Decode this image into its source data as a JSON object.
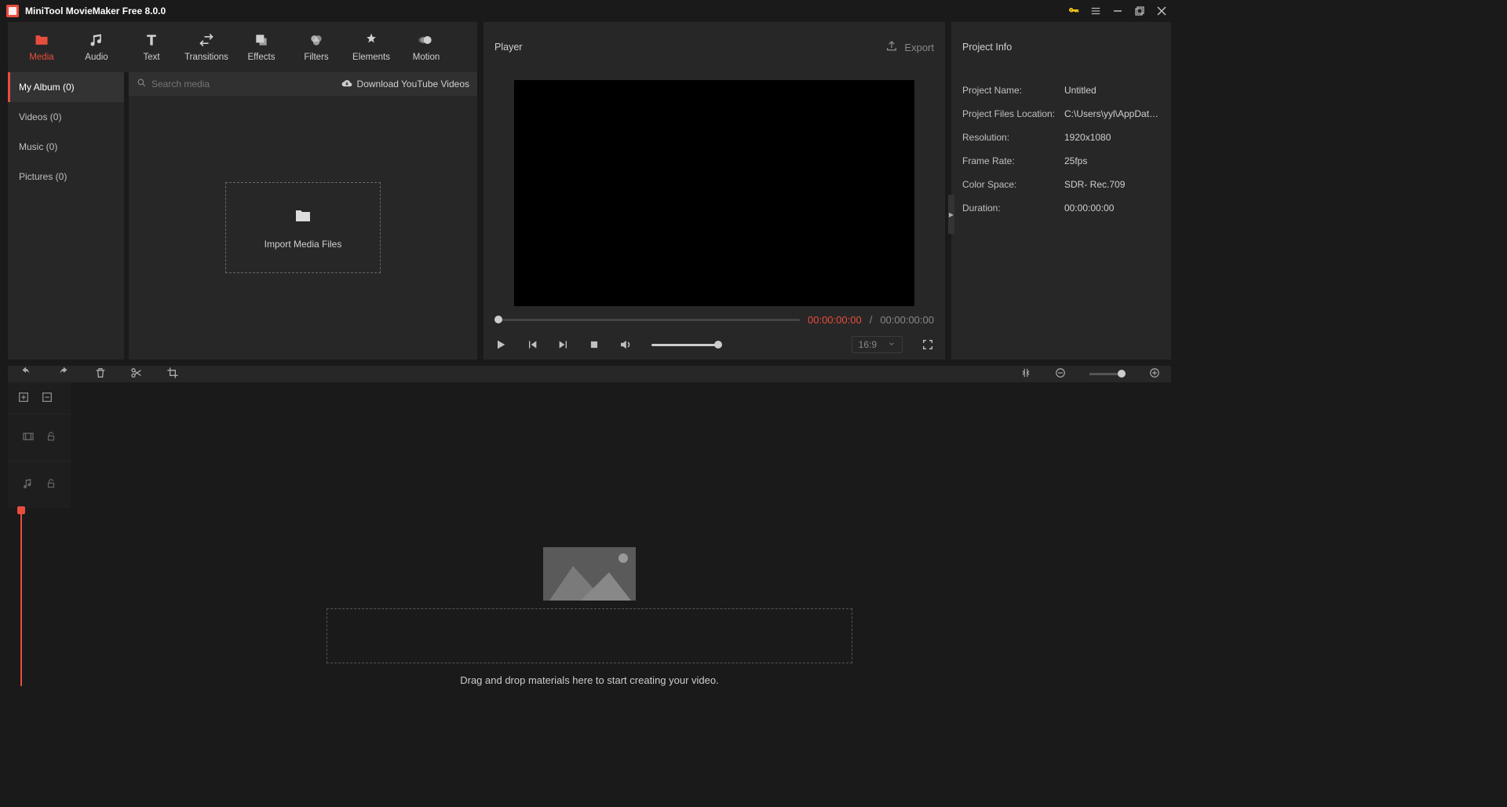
{
  "app": {
    "title": "MiniTool MovieMaker Free 8.0.0"
  },
  "tabs": {
    "media": "Media",
    "audio": "Audio",
    "text": "Text",
    "transitions": "Transitions",
    "effects": "Effects",
    "filters": "Filters",
    "elements": "Elements",
    "motion": "Motion"
  },
  "sidebar": {
    "album": "My Album (0)",
    "videos": "Videos (0)",
    "music": "Music (0)",
    "pictures": "Pictures (0)"
  },
  "media": {
    "search_placeholder": "Search media",
    "download_link": "Download YouTube Videos",
    "import_label": "Import Media Files"
  },
  "player": {
    "title": "Player",
    "export_label": "Export",
    "cur": "00:00:00:00",
    "sep": " / ",
    "dur": "00:00:00:00",
    "ratio": "16:9"
  },
  "info": {
    "title": "Project Info",
    "name_k": "Project Name:",
    "name_v": "Untitled",
    "loc_k": "Project Files Location:",
    "loc_v": "C:\\Users\\yyl\\AppDat…",
    "res_k": "Resolution:",
    "res_v": "1920x1080",
    "fps_k": "Frame Rate:",
    "fps_v": "25fps",
    "cs_k": "Color Space:",
    "cs_v": "SDR- Rec.709",
    "dur_k": "Duration:",
    "dur_v": "00:00:00:00"
  },
  "timeline": {
    "drop_text": "Drag and drop materials here to start creating your video."
  }
}
